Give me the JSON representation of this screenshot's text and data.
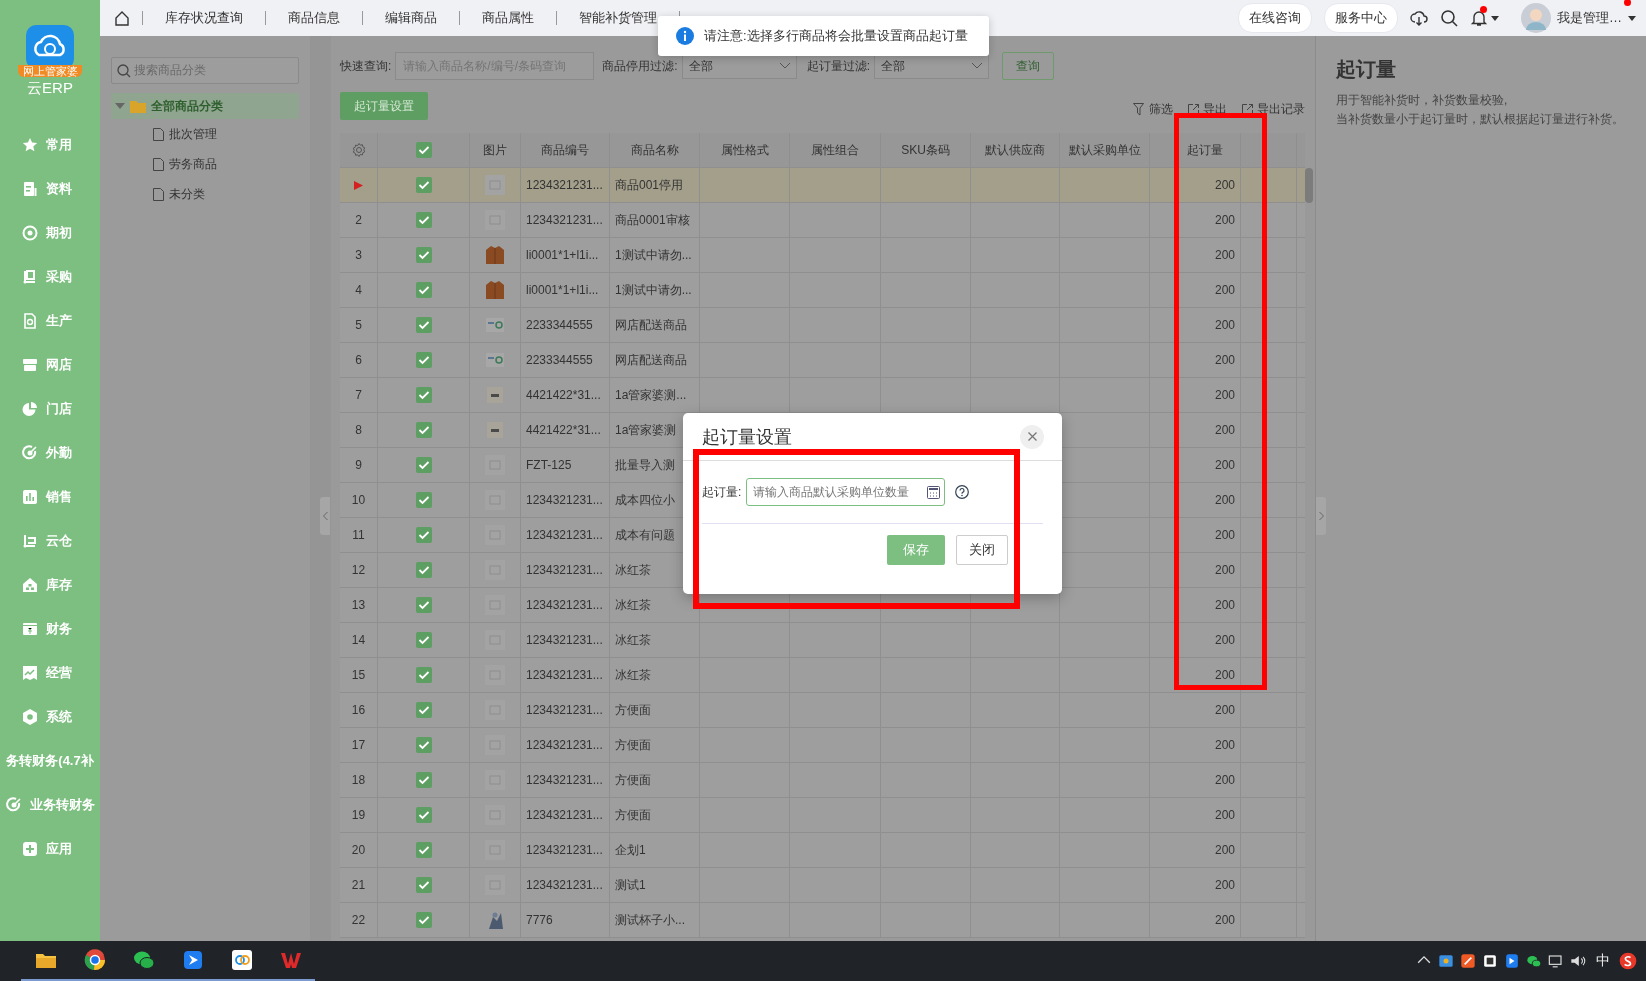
{
  "app": {
    "logo_badge": "网上管家婆",
    "name": "云ERP"
  },
  "nav": [
    {
      "label": "常用"
    },
    {
      "label": "资料"
    },
    {
      "label": "期初"
    },
    {
      "label": "采购"
    },
    {
      "label": "生产"
    },
    {
      "label": "网店"
    },
    {
      "label": "门店"
    },
    {
      "label": "外勤"
    },
    {
      "label": "销售"
    },
    {
      "label": "云仓"
    },
    {
      "label": "库存"
    },
    {
      "label": "财务"
    },
    {
      "label": "经营"
    },
    {
      "label": "系统"
    },
    {
      "label": "务转财务(4.7补"
    },
    {
      "label": "业务转财务"
    },
    {
      "label": "应用"
    }
  ],
  "top_tabs": [
    "库存状况查询",
    "商品信息",
    "编辑商品",
    "商品属性",
    "智能补货管理"
  ],
  "top_actions": [
    "在线咨询",
    "服务中心"
  ],
  "notifications": {
    "unread": true
  },
  "user": {
    "name": "我是管理…",
    "unread": true
  },
  "toast": {
    "text": "请注意:选择多行商品将会批量设置商品起订量"
  },
  "category_panel": {
    "search_placeholder": "搜索商品分类",
    "tree": [
      {
        "label": "全部商品分类",
        "expanded": true,
        "selected": true,
        "children": [
          {
            "label": "批次管理",
            "selected": false
          },
          {
            "label": "劳务商品",
            "selected": false
          },
          {
            "label": "未分类",
            "selected": false
          }
        ]
      }
    ]
  },
  "filters": {
    "quick": {
      "label": "快速查询:",
      "placeholder": "请输入商品名称/编号/条码查询"
    },
    "disabled_filter": {
      "label": "商品停用过滤:",
      "value": "全部"
    },
    "moq_filter": {
      "label": "起订量过滤:",
      "value": "全部"
    },
    "query_button": "查询"
  },
  "primary_button": "起订量设置",
  "toolbar": [
    "筛选",
    "导出",
    "导出记录"
  ],
  "table": {
    "all_checked": true,
    "columns": [
      "图片",
      "商品编号",
      "商品名称",
      "属性格式",
      "属性组合",
      "SKU条码",
      "默认供应商",
      "默认采购单位",
      "起订量"
    ],
    "rows": [
      {
        "current": true,
        "selected": true,
        "checked": true,
        "image": {
          "kind": "placeholder"
        },
        "code": "1234321231...",
        "name": "商品001停用",
        "moq": "200"
      },
      {
        "number": "2",
        "current": false,
        "selected": false,
        "checked": true,
        "image": {
          "kind": "placeholder"
        },
        "code": "1234321231...",
        "name": "商品0001审核",
        "moq": "200"
      },
      {
        "number": "3",
        "current": false,
        "selected": false,
        "checked": true,
        "image": {
          "kind": "jacket"
        },
        "code": "li0001*1+l1i...",
        "name": "1测试中请勿...",
        "moq": "200"
      },
      {
        "number": "4",
        "current": false,
        "selected": false,
        "checked": true,
        "image": {
          "kind": "jacket"
        },
        "code": "li0001*1+l1i...",
        "name": "1测试中请勿...",
        "moq": "200"
      },
      {
        "number": "5",
        "current": false,
        "selected": false,
        "checked": true,
        "image": {
          "kind": "label"
        },
        "code": "2233344555",
        "name": "网店配送商品",
        "moq": "200"
      },
      {
        "number": "6",
        "current": false,
        "selected": false,
        "checked": true,
        "image": {
          "kind": "label"
        },
        "code": "2233344555",
        "name": "网店配送商品",
        "moq": "200"
      },
      {
        "number": "7",
        "current": false,
        "selected": false,
        "checked": true,
        "image": {
          "kind": "package"
        },
        "code": "4421422*31...",
        "name": "1a管家婆测...",
        "moq": "200"
      },
      {
        "number": "8",
        "current": false,
        "selected": false,
        "checked": true,
        "image": {
          "kind": "package"
        },
        "code": "4421422*31...",
        "name": "1a管家婆测",
        "moq": "200"
      },
      {
        "number": "9",
        "current": false,
        "selected": false,
        "checked": true,
        "image": {
          "kind": "placeholder"
        },
        "code": "FZT-125",
        "name": "批量导入测",
        "moq": "200"
      },
      {
        "number": "10",
        "current": false,
        "selected": false,
        "checked": true,
        "image": {
          "kind": "placeholder"
        },
        "code": "1234321231...",
        "name": "成本四位小",
        "moq": "200"
      },
      {
        "number": "11",
        "current": false,
        "selected": false,
        "checked": true,
        "image": {
          "kind": "placeholder"
        },
        "code": "1234321231...",
        "name": "成本有问题",
        "moq": "200"
      },
      {
        "number": "12",
        "current": false,
        "selected": false,
        "checked": true,
        "image": {
          "kind": "placeholder"
        },
        "code": "1234321231...",
        "name": "冰红茶",
        "moq": "200"
      },
      {
        "number": "13",
        "current": false,
        "selected": false,
        "checked": true,
        "image": {
          "kind": "placeholder"
        },
        "code": "1234321231...",
        "name": "冰红茶",
        "moq": "200"
      },
      {
        "number": "14",
        "current": false,
        "selected": false,
        "checked": true,
        "image": {
          "kind": "placeholder"
        },
        "code": "1234321231...",
        "name": "冰红茶",
        "moq": "200"
      },
      {
        "number": "15",
        "current": false,
        "selected": false,
        "checked": true,
        "image": {
          "kind": "placeholder"
        },
        "code": "1234321231...",
        "name": "冰红茶",
        "moq": "200"
      },
      {
        "number": "16",
        "current": false,
        "selected": false,
        "checked": true,
        "image": {
          "kind": "placeholder"
        },
        "code": "1234321231...",
        "name": "方便面",
        "moq": "200"
      },
      {
        "number": "17",
        "current": false,
        "selected": false,
        "checked": true,
        "image": {
          "kind": "placeholder"
        },
        "code": "1234321231...",
        "name": "方便面",
        "moq": "200"
      },
      {
        "number": "18",
        "current": false,
        "selected": false,
        "checked": true,
        "image": {
          "kind": "placeholder"
        },
        "code": "1234321231...",
        "name": "方便面",
        "moq": "200"
      },
      {
        "number": "19",
        "current": false,
        "selected": false,
        "checked": true,
        "image": {
          "kind": "placeholder"
        },
        "code": "1234321231...",
        "name": "方便面",
        "moq": "200"
      },
      {
        "number": "20",
        "current": false,
        "selected": false,
        "checked": true,
        "image": {
          "kind": "placeholder"
        },
        "code": "1234321231...",
        "name": "企划1",
        "moq": "200"
      },
      {
        "number": "21",
        "current": false,
        "selected": false,
        "checked": true,
        "image": {
          "kind": "placeholder"
        },
        "code": "1234321231...",
        "name": "测试1",
        "moq": "200"
      },
      {
        "number": "22",
        "current": false,
        "selected": false,
        "checked": true,
        "image": {
          "kind": "figure"
        },
        "code": "7776",
        "name": "测试杯子小...",
        "moq": "200"
      }
    ]
  },
  "side_info": {
    "title": "起订量",
    "lines": [
      "用于智能补货时，补货数量校验,",
      "当补货数量小于起订量时，默认根据起订量进行补货。"
    ]
  },
  "dialog": {
    "title": "起订量设置",
    "field_label": "起订量:",
    "placeholder": "请输入商品默认采购单位数量",
    "buttons": [
      "保存",
      "关闭"
    ]
  },
  "annotations": {
    "column_highlight": true,
    "field_highlight": true
  },
  "taskbar": {
    "ime": "中"
  }
}
